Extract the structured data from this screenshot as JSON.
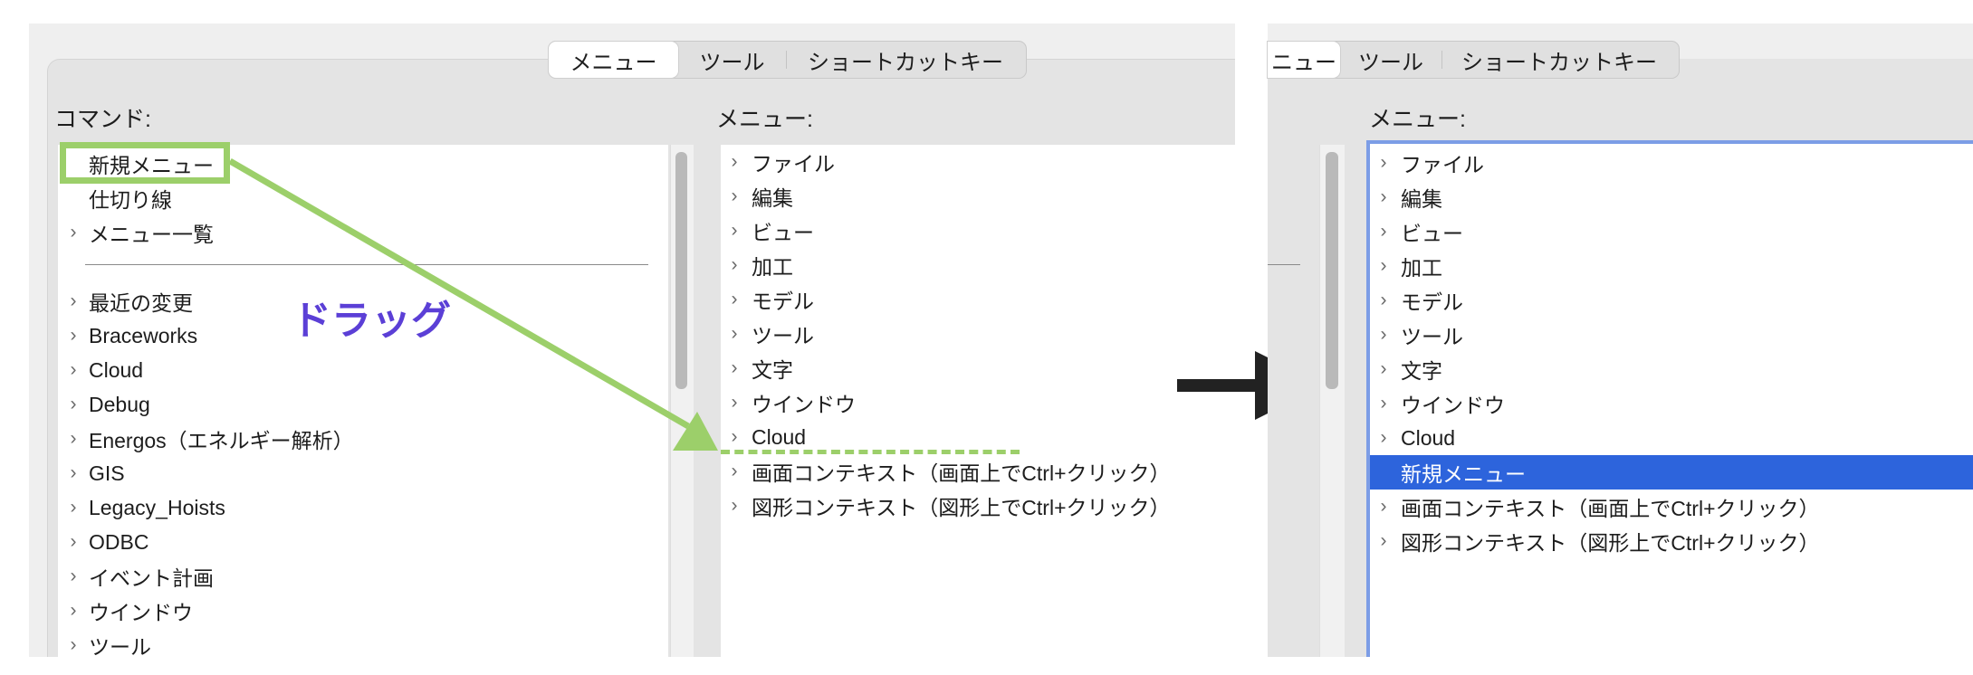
{
  "left": {
    "tabs": [
      "メニュー",
      "ツール",
      "ショートカットキー"
    ],
    "commands_label": "コマンド:",
    "menu_label": "メニュー:",
    "commands": [
      {
        "label": "新規メニュー",
        "chevron": false
      },
      {
        "label": "仕切り線",
        "chevron": false
      },
      {
        "label": "メニュー一覧",
        "chevron": true
      },
      {
        "label": "最近の変更",
        "chevron": true
      },
      {
        "label": "Braceworks",
        "chevron": true
      },
      {
        "label": "Cloud",
        "chevron": true
      },
      {
        "label": "Debug",
        "chevron": true
      },
      {
        "label": "Energos（エネルギー解析）",
        "chevron": true
      },
      {
        "label": "GIS",
        "chevron": true
      },
      {
        "label": "Legacy_Hoists",
        "chevron": true
      },
      {
        "label": "ODBC",
        "chevron": true
      },
      {
        "label": "イベント計画",
        "chevron": true
      },
      {
        "label": "ウインドウ",
        "chevron": true
      },
      {
        "label": "ツール",
        "chevron": true
      }
    ],
    "menus": [
      "ファイル",
      "編集",
      "ビュー",
      "加工",
      "モデル",
      "ツール",
      "文字",
      "ウインドウ",
      "Cloud",
      "画面コンテキスト（画面上でCtrl+クリック）",
      "図形コンテキスト（図形上でCtrl+クリック）"
    ]
  },
  "annotation": {
    "drag_label": "ドラッグ",
    "drag_color": "#5b3fd6",
    "highlight_color": "#9ccf6a",
    "arrow_color": "#222222"
  },
  "right": {
    "tabs": [
      "ニュー",
      "ツール",
      "ショートカットキー"
    ],
    "menu_label": "メニュー:",
    "menus": [
      {
        "label": "ファイル",
        "chevron": true
      },
      {
        "label": "編集",
        "chevron": true
      },
      {
        "label": "ビュー",
        "chevron": true
      },
      {
        "label": "加工",
        "chevron": true
      },
      {
        "label": "モデル",
        "chevron": true
      },
      {
        "label": "ツール",
        "chevron": true
      },
      {
        "label": "文字",
        "chevron": true
      },
      {
        "label": "ウインドウ",
        "chevron": true
      },
      {
        "label": "Cloud",
        "chevron": true
      },
      {
        "label": "新規メニュー",
        "chevron": false,
        "selected": true
      },
      {
        "label": "画面コンテキスト（画面上でCtrl+クリック）",
        "chevron": true
      },
      {
        "label": "図形コンテキスト（図形上でCtrl+クリック）",
        "chevron": true
      }
    ],
    "selection_color": "#2d64dc",
    "focus_color": "#7c9de6"
  }
}
